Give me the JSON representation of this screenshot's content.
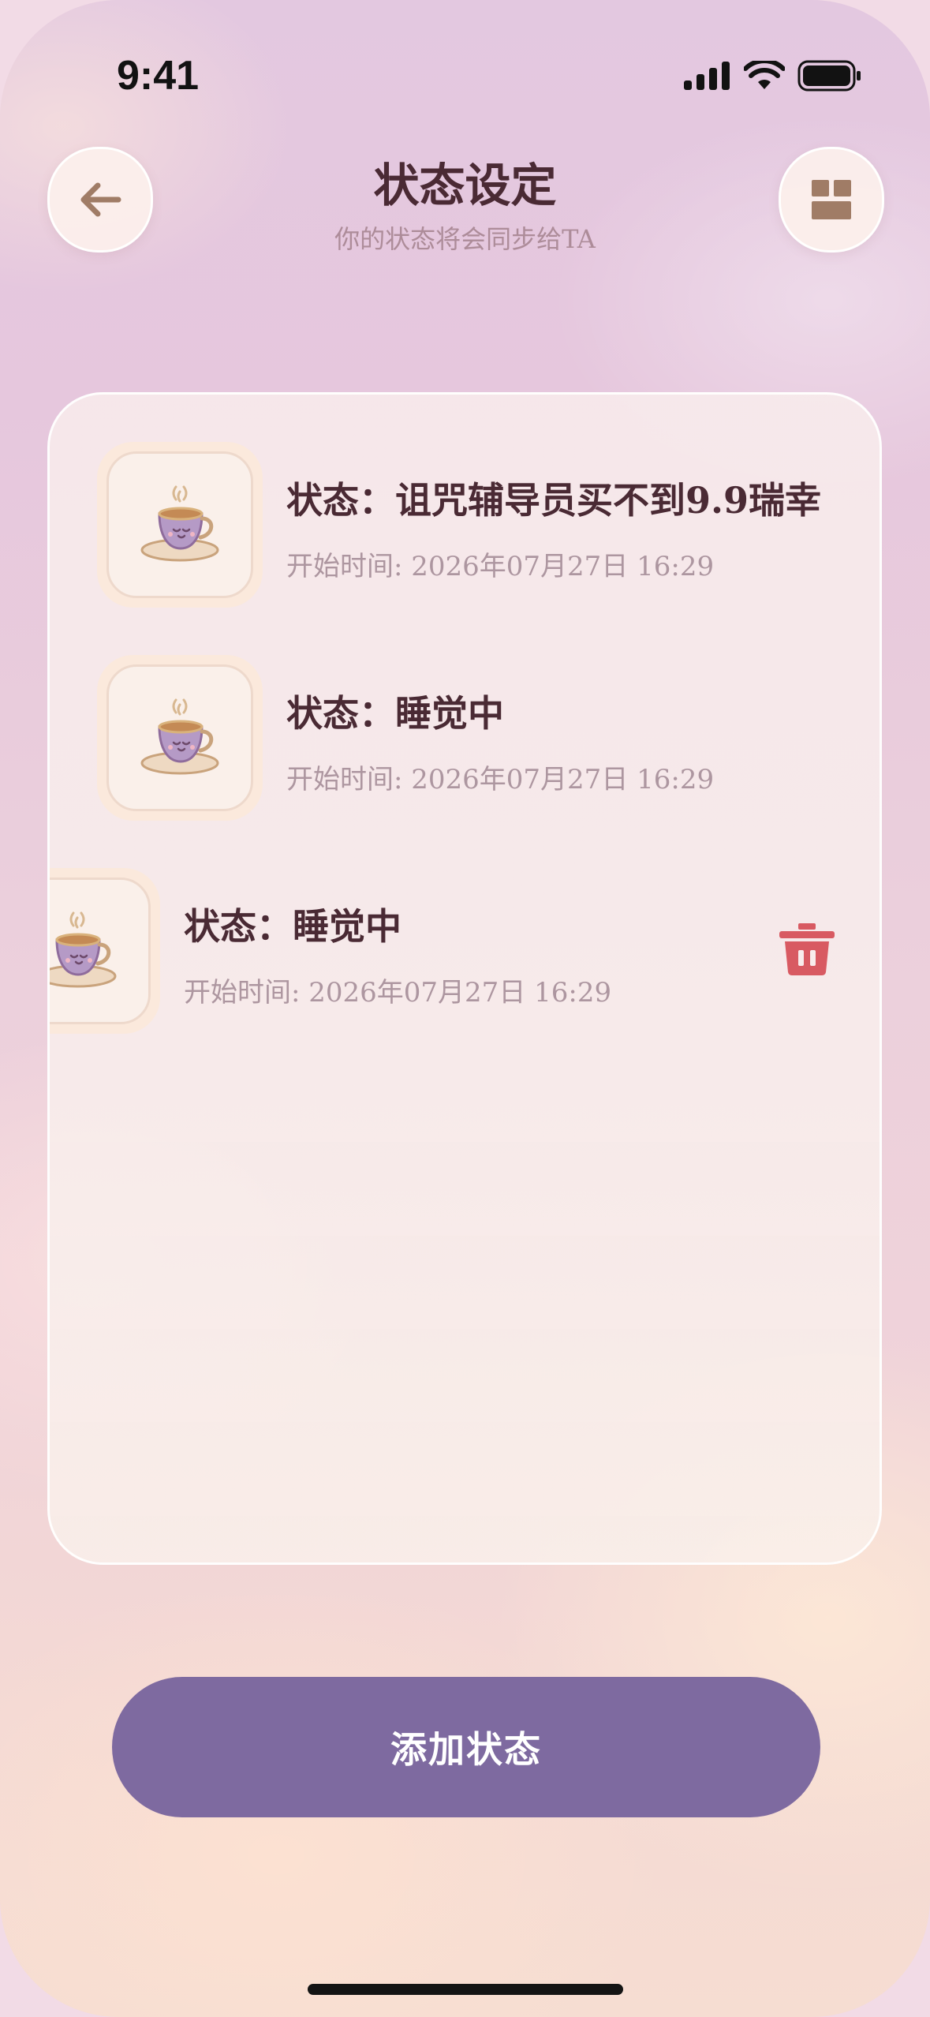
{
  "status_bar": {
    "time": "9:41"
  },
  "header": {
    "title": "状态设定",
    "subtitle": "你的状态将会同步给TA"
  },
  "status_list": [
    {
      "title": "状态：诅咒辅导员买不到9.9瑞幸",
      "start_time": "开始时间: 2026年07月27日  16:29",
      "icon": "teacup-icon"
    },
    {
      "title": "状态：睡觉中",
      "start_time": "开始时间: 2026年07月27日  16:29",
      "icon": "teacup-icon"
    },
    {
      "title": "状态：睡觉中",
      "start_time": "开始时间: 2026年07月27日  16:29",
      "icon": "teacup-icon",
      "swiped_to_reveal": "trash-icon"
    }
  ],
  "add_button": {
    "label": "添加状态"
  },
  "colors": {
    "accent": "#7e6aa0",
    "title_text": "#4a2a34",
    "delete_red": "#d85a62",
    "icon_brown": "#a07c66"
  }
}
